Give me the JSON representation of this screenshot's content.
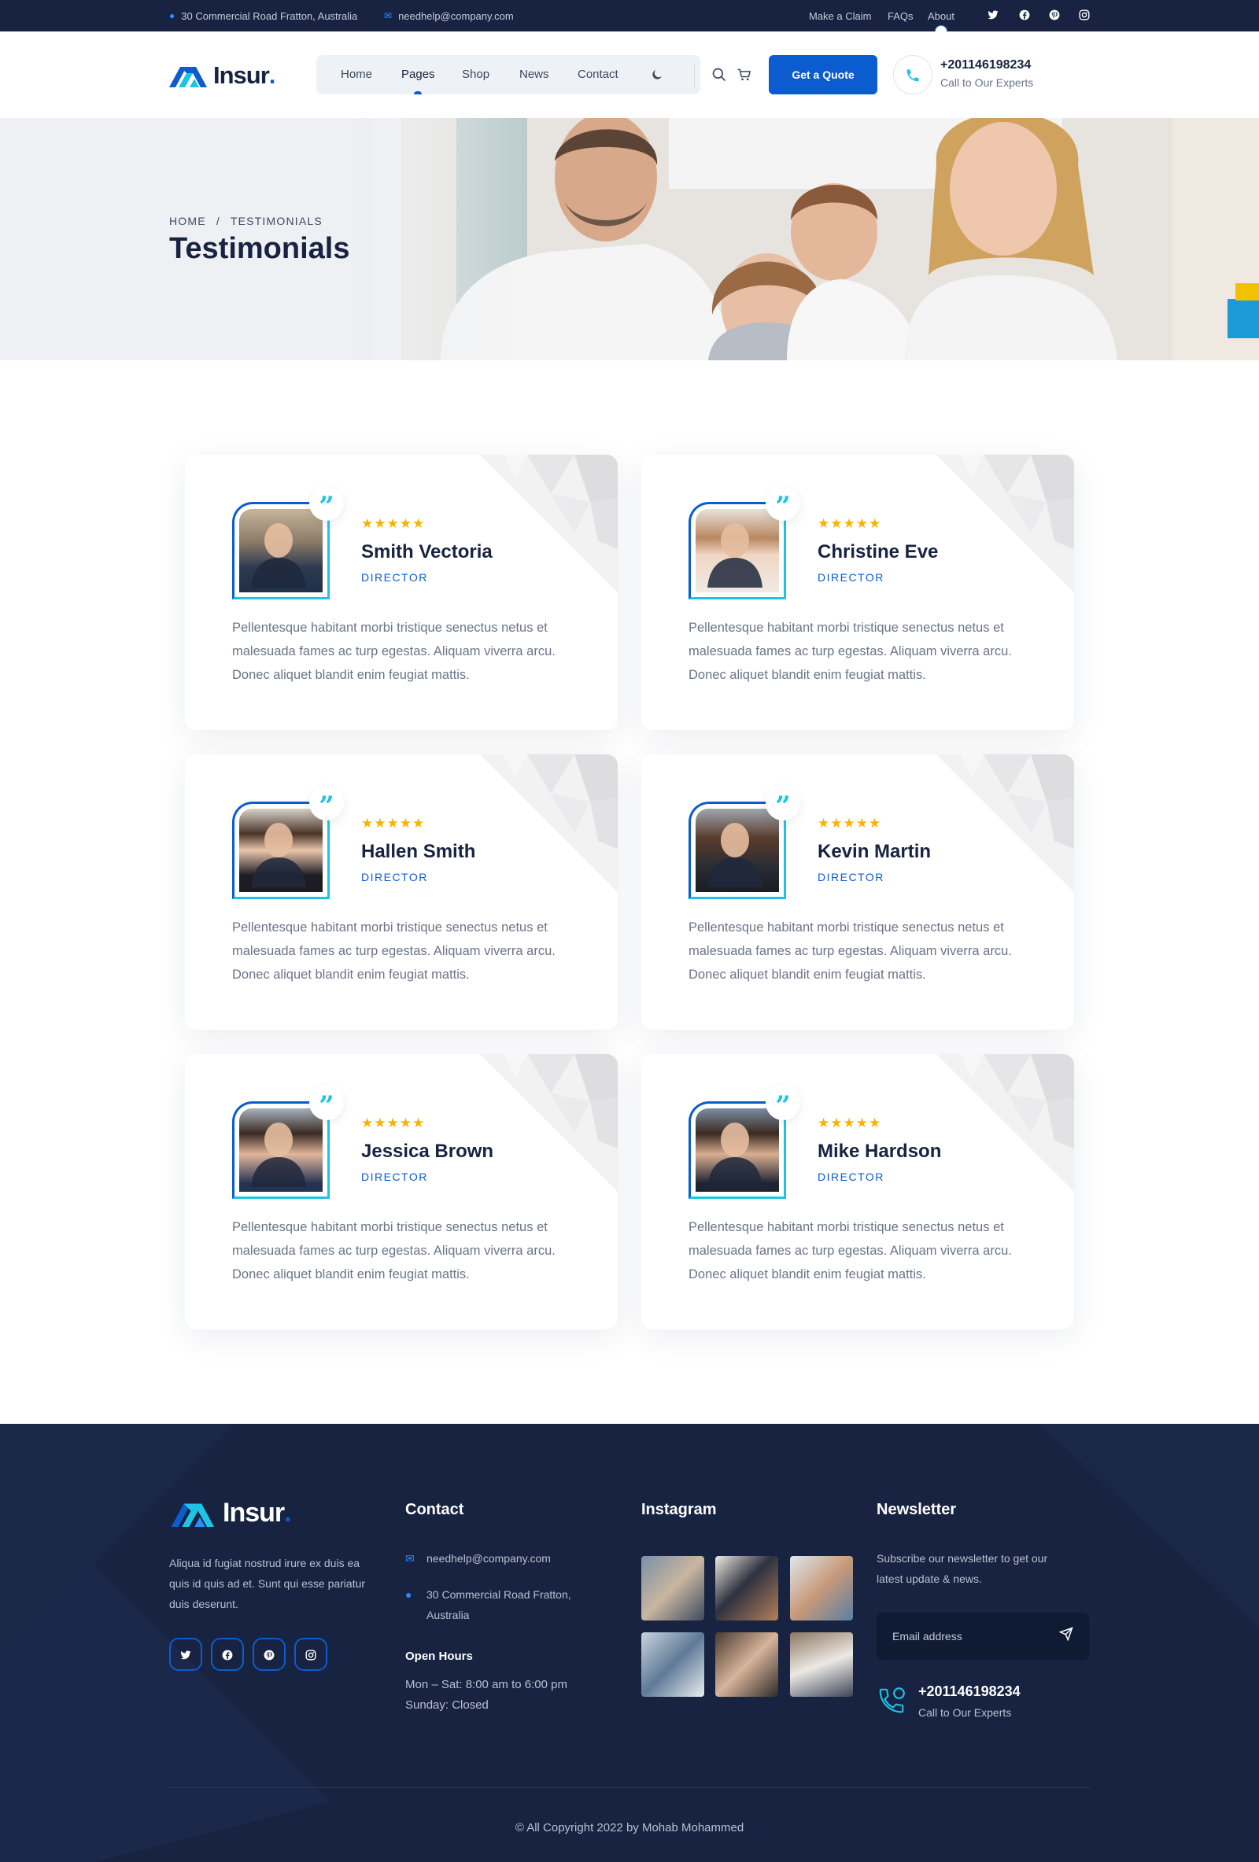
{
  "topbar": {
    "address": "30 Commercial Road Fratton, Australia",
    "email": "needhelp@company.com",
    "links": [
      "Make a Claim",
      "FAQs",
      "About"
    ],
    "social_icons": [
      "twitter-icon",
      "facebook-icon",
      "pinterest-icon",
      "instagram-icon"
    ]
  },
  "header": {
    "logo_text": "Insur",
    "logo_dot": ".",
    "nav": [
      "Home",
      "Pages",
      "Shop",
      "News",
      "Contact"
    ],
    "active_nav": "Pages",
    "quote_button": "Get a Quote",
    "phone": "+201146198234",
    "phone_sub": "Call to Our Experts"
  },
  "hero": {
    "breadcrumb_home": "HOME",
    "breadcrumb_sep": "/",
    "breadcrumb_current": "TESTIMONIALS",
    "title": "Testimonials"
  },
  "testimonials": [
    {
      "name": "Smith Vectoria",
      "role": "DIRECTOR",
      "rating": 5,
      "text": "Pellentesque habitant morbi tristique senectus netus et malesuada fames ac turp egestas. Aliquam viverra arcu. Donec aliquet blandit enim feugiat mattis."
    },
    {
      "name": "Christine Eve",
      "role": "DIRECTOR",
      "rating": 5,
      "text": "Pellentesque habitant morbi tristique senectus netus et malesuada fames ac turp egestas. Aliquam viverra arcu. Donec aliquet blandit enim feugiat mattis."
    },
    {
      "name": "Hallen Smith",
      "role": "DIRECTOR",
      "rating": 5,
      "text": "Pellentesque habitant morbi tristique senectus netus et malesuada fames ac turp egestas. Aliquam viverra arcu. Donec aliquet blandit enim feugiat mattis."
    },
    {
      "name": "Kevin Martin",
      "role": "DIRECTOR",
      "rating": 5,
      "text": "Pellentesque habitant morbi tristique senectus netus et malesuada fames ac turp egestas. Aliquam viverra arcu. Donec aliquet blandit enim feugiat mattis."
    },
    {
      "name": "Jessica Brown",
      "role": "DIRECTOR",
      "rating": 5,
      "text": "Pellentesque habitant morbi tristique senectus netus et malesuada fames ac turp egestas. Aliquam viverra arcu. Donec aliquet blandit enim feugiat mattis."
    },
    {
      "name": "Mike Hardson",
      "role": "DIRECTOR",
      "rating": 5,
      "text": "Pellentesque habitant morbi tristique senectus netus et malesuada fames ac turp egestas. Aliquam viverra arcu. Donec aliquet blandit enim feugiat mattis."
    }
  ],
  "footer": {
    "about": "Aliqua id fugiat nostrud irure ex duis ea quis id quis ad et. Sunt qui esse pariatur duis deserunt.",
    "contact_title": "Contact",
    "contact_email": "needhelp@company.com",
    "contact_address": "30 Commercial Road Fratton, Australia",
    "hours_title": "Open Hours",
    "hours_weekday": "Mon – Sat: 8:00 am to 6:00 pm",
    "hours_sunday": "Sunday: Closed",
    "instagram_title": "Instagram",
    "newsletter_title": "Newsletter",
    "newsletter_text": "Subscribe our newsletter to get our latest update & news.",
    "email_placeholder": "Email address",
    "phone": "+201146198234",
    "phone_sub": "Call to Our Experts",
    "copyright": "© All Copyright 2022 by Mohab Mohammed"
  },
  "colors": {
    "navy": "#172340",
    "primary": "#0b5ccf",
    "accent": "#1ec4e6",
    "star": "#f6b300"
  }
}
